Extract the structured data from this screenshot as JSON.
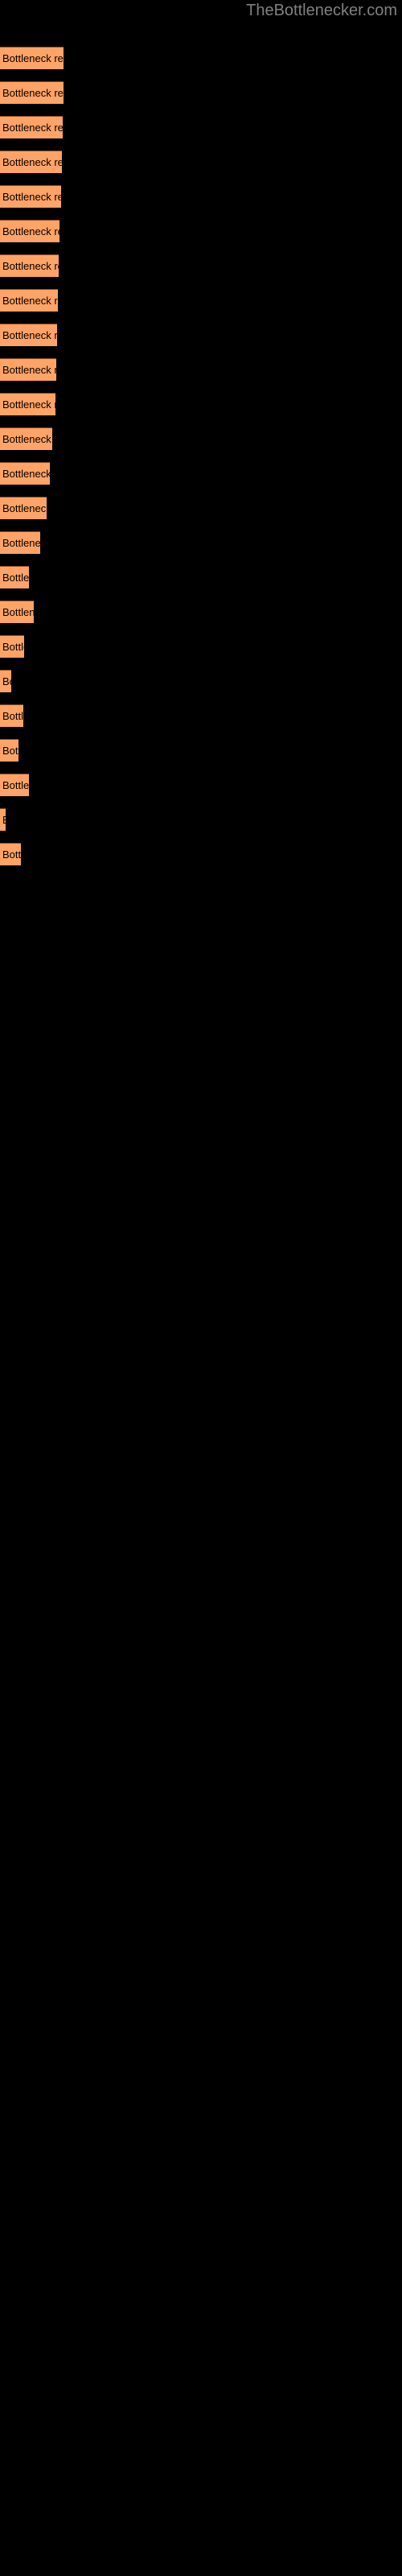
{
  "site": {
    "title": "TheBottlenecker.com",
    "title_color": "#808080",
    "background_color": "#000000"
  },
  "chart_data": {
    "type": "bar",
    "orientation": "horizontal",
    "title": "TheBottlenecker.com",
    "xlabel": "",
    "ylabel": "",
    "bar_color": "#ffa366",
    "bar_border_color": "#8a4a20",
    "label_color": "#000000",
    "background": "#000000",
    "grid": false,
    "legend": false,
    "axis_visible": false,
    "bar_label_text": "Bottleneck result",
    "xlim": [
      0,
      160
    ],
    "categories": [
      "Bottleneck result",
      "Bottleneck result",
      "Bottleneck result",
      "Bottleneck result",
      "Bottleneck result",
      "Bottleneck result",
      "Bottleneck result",
      "Bottleneck result",
      "Bottleneck result",
      "Bottleneck result",
      "Bottleneck result",
      "Bottleneck result",
      "Bottleneck result",
      "Bottleneck result",
      "Bottleneck result",
      "Bottleneck result",
      "Bottleneck result",
      "Bottleneck result",
      "Bottleneck result",
      "Bottleneck result",
      "Bottleneck result",
      "Bottleneck result"
    ],
    "values": [
      79,
      79,
      78,
      77,
      76,
      74,
      73,
      72,
      70,
      68,
      65,
      60,
      57,
      54,
      47,
      42,
      40,
      35,
      29,
      33,
      30,
      38,
      9,
      30
    ],
    "bars": [
      {
        "index": 1,
        "label": "Bottleneck result",
        "value": 79,
        "y": 58,
        "width": 79
      },
      {
        "index": 2,
        "label": "Bottleneck result",
        "value": 79,
        "y": 101,
        "width": 79
      },
      {
        "index": 3,
        "label": "Bottleneck result",
        "value": 78,
        "y": 144,
        "width": 78
      },
      {
        "index": 4,
        "label": "Bottleneck result",
        "value": 77,
        "y": 187,
        "width": 77
      },
      {
        "index": 5,
        "label": "Bottleneck result",
        "value": 76,
        "y": 230,
        "width": 76
      },
      {
        "index": 6,
        "label": "Bottleneck result",
        "value": 74,
        "y": 273,
        "width": 74
      },
      {
        "index": 7,
        "label": "Bottleneck result",
        "value": 73,
        "y": 316,
        "width": 73
      },
      {
        "index": 8,
        "label": "Bottleneck result",
        "value": 72,
        "y": 359,
        "width": 72
      },
      {
        "index": 9,
        "label": "Bottleneck result",
        "value": 71,
        "y": 402,
        "width": 71
      },
      {
        "index": 10,
        "label": "Bottleneck result",
        "value": 70,
        "y": 445,
        "width": 70
      },
      {
        "index": 11,
        "label": "Bottleneck result",
        "value": 69,
        "y": 488,
        "width": 69
      },
      {
        "index": 12,
        "label": "Bottleneck result",
        "value": 65,
        "y": 531,
        "width": 65
      },
      {
        "index": 13,
        "label": "Bottleneck result",
        "value": 62,
        "y": 574,
        "width": 62
      },
      {
        "index": 14,
        "label": "Bottleneck result",
        "value": 58,
        "y": 617,
        "width": 58
      },
      {
        "index": 15,
        "label": "Bottleneck result",
        "value": 50,
        "y": 660,
        "width": 50
      },
      {
        "index": 16,
        "label": "Bottleneck result",
        "value": 36,
        "y": 703,
        "width": 36
      },
      {
        "index": 17,
        "label": "Bottleneck result",
        "value": 42,
        "y": 746,
        "width": 42
      },
      {
        "index": 18,
        "label": "Bottleneck result",
        "value": 30,
        "y": 789,
        "width": 30
      },
      {
        "index": 19,
        "label": "Bottleneck result",
        "value": 14,
        "y": 832,
        "width": 14
      },
      {
        "index": 20,
        "label": "Bottleneck result",
        "value": 29,
        "y": 875,
        "width": 29
      },
      {
        "index": 21,
        "label": "Bottleneck result",
        "value": 23,
        "y": 918,
        "width": 23
      },
      {
        "index": 22,
        "label": "Bottleneck result",
        "value": 36,
        "y": 961,
        "width": 36
      },
      {
        "index": 23,
        "label": "Bottleneck result",
        "value": 7,
        "y": 1004,
        "width": 7
      },
      {
        "index": 24,
        "label": "Bottleneck result",
        "value": 26,
        "y": 1047,
        "width": 26
      }
    ]
  }
}
